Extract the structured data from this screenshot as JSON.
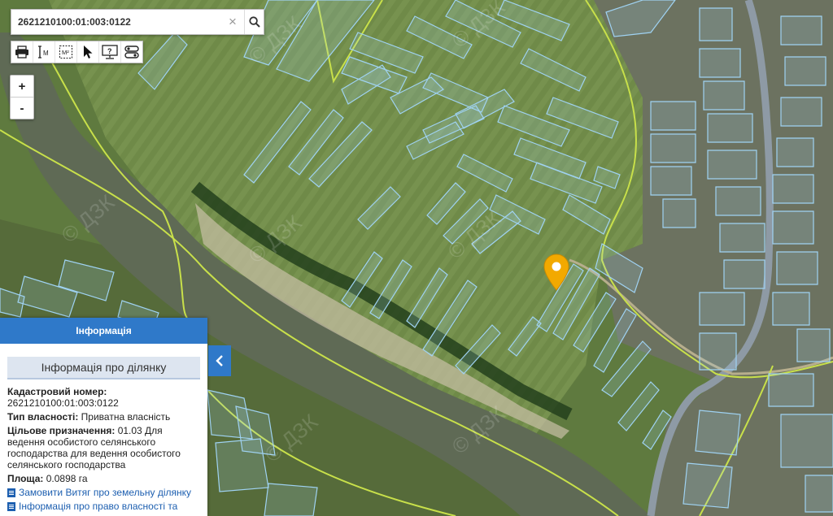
{
  "search": {
    "value": "2621210100:01:003:0122",
    "clear_label": "×"
  },
  "toolbar": {
    "tools": [
      {
        "icon": "print-icon"
      },
      {
        "icon": "measure-length-icon",
        "label": "M"
      },
      {
        "icon": "measure-area-icon",
        "label": "M²"
      },
      {
        "icon": "pointer-icon"
      },
      {
        "icon": "identify-icon",
        "label": "?"
      },
      {
        "icon": "layers-icon"
      }
    ]
  },
  "zoom": {
    "in_label": "+",
    "out_label": "-"
  },
  "watermark": "© ДЗК",
  "info_panel": {
    "header": "Інформація",
    "subtitle": "Інформація про ділянку",
    "cadastral_label": "Кадастровий номер:",
    "cadastral_value": "2621210100:01:003:0122",
    "ownership_label": "Тип власності:",
    "ownership_value": "Приватна власність",
    "purpose_label": "Цільове призначення:",
    "purpose_value": "01.03 Для ведення особистого селянського господарства для ведення особистого селянського господарства",
    "area_label": "Площа:",
    "area_value": "0.0898 га",
    "link_extract": "Замовити Витяг про земельну ділянку",
    "link_rights": "Інформація про право власності та"
  },
  "colors": {
    "accent": "#2f79c9",
    "parcel_outline": "#9fd2f2",
    "boundary_line": "#c8e04a",
    "marker": "#f2a900",
    "river": "#5f6a55"
  }
}
